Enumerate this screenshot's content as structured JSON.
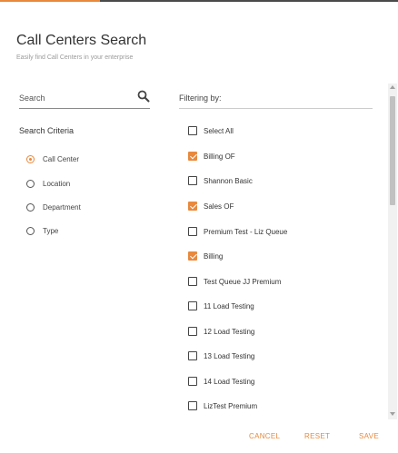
{
  "dialog": {
    "title": "Call Centers Search",
    "subtitle": "Easily find Call Centers in your enterprise"
  },
  "search": {
    "placeholder": "Search",
    "icon": "search-icon"
  },
  "criteria": {
    "label": "Search Criteria",
    "options": [
      {
        "label": "Call Center",
        "selected": true
      },
      {
        "label": "Location",
        "selected": false
      },
      {
        "label": "Department",
        "selected": false
      },
      {
        "label": "Type",
        "selected": false
      }
    ]
  },
  "filter": {
    "label": "Filtering by:",
    "items": [
      {
        "label": "Select All",
        "checked": false
      },
      {
        "label": "Billing OF",
        "checked": true
      },
      {
        "label": "Shannon Basic",
        "checked": false
      },
      {
        "label": "Sales OF",
        "checked": true
      },
      {
        "label": "Premium Test - Liz Queue",
        "checked": false
      },
      {
        "label": "Billing",
        "checked": true
      },
      {
        "label": "Test Queue JJ Premium",
        "checked": false
      },
      {
        "label": "11 Load Testing",
        "checked": false
      },
      {
        "label": "12 Load Testing",
        "checked": false
      },
      {
        "label": "13 Load Testing",
        "checked": false
      },
      {
        "label": "14 Load Testing",
        "checked": false
      },
      {
        "label": "LizTest Premium",
        "checked": false
      }
    ]
  },
  "footer": {
    "cancel": "CANCEL",
    "reset": "RESET",
    "save": "SAVE"
  },
  "colors": {
    "accent": "#e8893c",
    "topbar": "#4a4a4a"
  }
}
